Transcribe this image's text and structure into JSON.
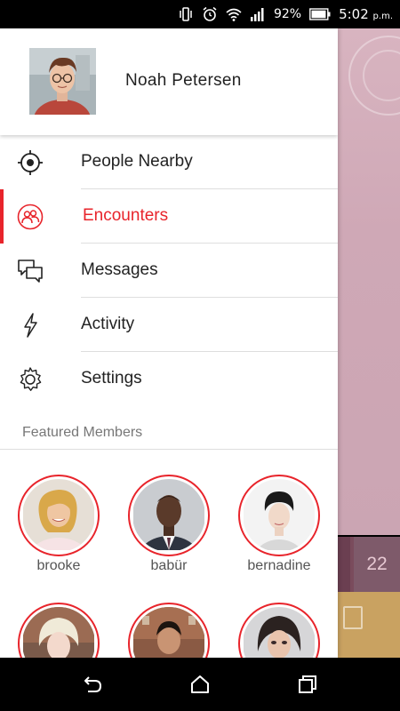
{
  "status_bar": {
    "battery": "92%",
    "time": "5:02",
    "time_suffix": "p.m.",
    "icons": [
      "vibrate-icon",
      "alarm-icon",
      "wifi-icon",
      "signal-icon",
      "battery-icon"
    ]
  },
  "profile": {
    "name": "Noah Petersen"
  },
  "menu": {
    "items": [
      {
        "label": "People Nearby",
        "icon": "crosshair-icon",
        "active": false
      },
      {
        "label": "Encounters",
        "icon": "encounters-icon",
        "active": true
      },
      {
        "label": "Messages",
        "icon": "messages-icon",
        "active": false
      },
      {
        "label": "Activity",
        "icon": "lightning-icon",
        "active": false
      },
      {
        "label": "Settings",
        "icon": "gear-icon",
        "active": false
      }
    ]
  },
  "featured": {
    "title": "Featured Members",
    "members": [
      {
        "name": "brooke"
      },
      {
        "name": "babür"
      },
      {
        "name": "bernadine"
      },
      {
        "name": ""
      },
      {
        "name": ""
      },
      {
        "name": ""
      }
    ]
  },
  "background": {
    "count": "22"
  },
  "colors": {
    "accent": "#e8242b",
    "text": "#222222",
    "muted": "#777777",
    "divider": "#dedede"
  }
}
